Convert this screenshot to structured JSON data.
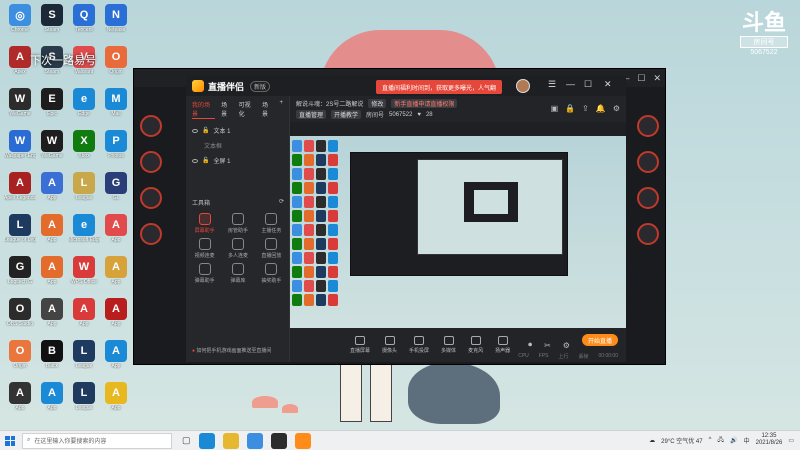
{
  "desktop": {
    "icons": [
      {
        "label": "Chrome",
        "color": "#3b8ee0",
        "glyph": "◎"
      },
      {
        "label": "Steam",
        "color": "#1b2838",
        "glyph": "S"
      },
      {
        "label": "Tencent",
        "color": "#2a6fd6",
        "glyph": "Q"
      },
      {
        "label": "Netease",
        "color": "#2a6fd6",
        "glyph": "N"
      },
      {
        "label": "Apex",
        "color": "#b12a2a",
        "glyph": "A"
      },
      {
        "label": "Steam",
        "color": "#2a3a4a",
        "glyph": "S"
      },
      {
        "label": "Valorant",
        "color": "#e14b4b",
        "glyph": "V"
      },
      {
        "label": "Origin",
        "color": "#e96b3c",
        "glyph": "O"
      },
      {
        "label": "WeGame",
        "color": "#2c2c2c",
        "glyph": "W"
      },
      {
        "label": "Epic",
        "color": "#1d1d1d",
        "glyph": "E"
      },
      {
        "label": "Edge",
        "color": "#1b8ad6",
        "glyph": "e"
      },
      {
        "label": "Mail",
        "color": "#1b8ad6",
        "glyph": "M"
      },
      {
        "label": "Wallpaper Engine",
        "color": "#2b6cd4",
        "glyph": "W"
      },
      {
        "label": "WeGame",
        "color": "#1e1e1e",
        "glyph": "W"
      },
      {
        "label": "Xbox",
        "color": "#107c10",
        "glyph": "X"
      },
      {
        "label": "Photos",
        "color": "#1b8ad6",
        "glyph": "P"
      },
      {
        "label": "Apex Legends",
        "color": "#a82222",
        "glyph": "A"
      },
      {
        "label": "App",
        "color": "#3b6fd6",
        "glyph": "A"
      },
      {
        "label": "League",
        "color": "#c8a84b",
        "glyph": "L"
      },
      {
        "label": "GL",
        "color": "#2a3f78",
        "glyph": "G"
      },
      {
        "label": "League of Legends",
        "color": "#1e3a5f",
        "glyph": "L"
      },
      {
        "label": "App",
        "color": "#e36b2c",
        "glyph": "A"
      },
      {
        "label": "Microsoft Edge",
        "color": "#1b8ad6",
        "glyph": "e"
      },
      {
        "label": "App",
        "color": "#e14b4b",
        "glyph": "A"
      },
      {
        "label": "Logitech G",
        "color": "#222222",
        "glyph": "G"
      },
      {
        "label": "App",
        "color": "#e36b2c",
        "glyph": "A"
      },
      {
        "label": "WPS Office",
        "color": "#d93a3a",
        "glyph": "W"
      },
      {
        "label": "App",
        "color": "#d8a23a",
        "glyph": "A"
      },
      {
        "label": "OBS Studio",
        "color": "#2c2c2c",
        "glyph": "O"
      },
      {
        "label": "App",
        "color": "#444444",
        "glyph": "A"
      },
      {
        "label": "App",
        "color": "#d93a3a",
        "glyph": "A"
      },
      {
        "label": "App",
        "color": "#b81e1e",
        "glyph": "A"
      },
      {
        "label": "Origin",
        "color": "#e9763c",
        "glyph": "O"
      },
      {
        "label": "Black",
        "color": "#111111",
        "glyph": "B"
      },
      {
        "label": "League",
        "color": "#1e3a5f",
        "glyph": "L"
      },
      {
        "label": "App",
        "color": "#1b8ad6",
        "glyph": "A"
      },
      {
        "label": "App",
        "color": "#333333",
        "glyph": "A"
      },
      {
        "label": "App",
        "color": "#1b8ad6",
        "glyph": "A"
      },
      {
        "label": "League",
        "color": "#1e3a5f",
        "glyph": "L"
      },
      {
        "label": "App",
        "color": "#e7b820",
        "glyph": "A"
      }
    ],
    "banner": "下次一路易号",
    "douyu": {
      "logo": "斗鱼",
      "tag": "房间号",
      "room": "5067522"
    }
  },
  "app": {
    "title": "直播伴侣",
    "version": "新版",
    "announcement": "直播间福利时间到，获取更多曝光，人气翻",
    "scene_tabs": [
      "我的场景",
      "场景",
      "可视化",
      "场景"
    ],
    "sources": [
      {
        "label": "文本 1",
        "sub": false
      },
      {
        "label": "文本框",
        "sub": true
      },
      {
        "label": "全屏 1",
        "sub": false
      }
    ],
    "toolbox_title": "工具箱",
    "tools": [
      {
        "label": "屏幕助手",
        "active": true
      },
      {
        "label": "房管助手",
        "active": false
      },
      {
        "label": "主播任务",
        "active": false
      },
      {
        "label": "视频连麦",
        "active": false
      },
      {
        "label": "多人连麦",
        "active": false
      },
      {
        "label": "直播回放",
        "active": false
      },
      {
        "label": "弹幕助手",
        "active": false
      },
      {
        "label": "弹幕库",
        "active": false
      },
      {
        "label": "抽奖助手",
        "active": false
      }
    ],
    "help_link": "如何把手机游戏画面推送至直播间",
    "info": {
      "line1_label": "解说斗魂：2S号二路解说",
      "line1_chip": "修改",
      "line1_chip_red": "新手直播申请直播权限",
      "line2_chips": [
        "直播管理",
        "开播教学"
      ],
      "room_label": "房间号",
      "room_value": "5067522",
      "fans": "28"
    },
    "bottom_tools": [
      "直播屏幕",
      "摄像头",
      "手机投屏",
      "多媒体",
      "麦克风",
      "扬声器"
    ],
    "go_live": "开始直播",
    "stats": [
      "CPU",
      "FPS",
      "上行",
      "丢帧",
      "00:00:00"
    ]
  },
  "taskbar": {
    "search_placeholder": "在这里输入你要搜索的内容",
    "weather": "29°C 空气优 47",
    "time": "12:35",
    "date": "2021/8/26"
  }
}
